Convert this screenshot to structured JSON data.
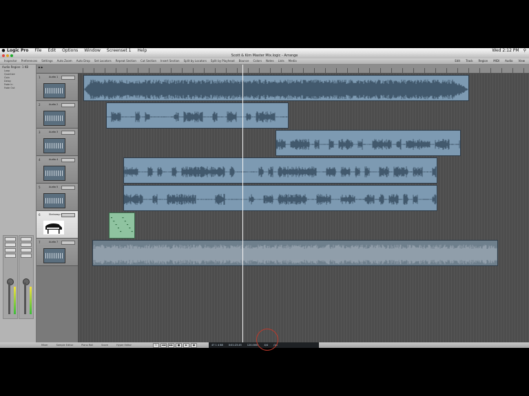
{
  "menubar": {
    "items": [
      "Logic Pro",
      "File",
      "Edit",
      "Options",
      "Window",
      "Screenset 1",
      "Help"
    ],
    "clock": "Wed 2:12 PM"
  },
  "window": {
    "title": "Scott & Kim Master Mix.logic - Arrange"
  },
  "toolbar": {
    "items": [
      "Inspector",
      "Preferences",
      "Settings",
      "Auto Zoom",
      "Auto Drop",
      "Set Locators",
      "Repeat Section",
      "Cut Section",
      "Insert Section",
      "Split by Locators",
      "Split by Playhead",
      "Bounce",
      "Colors",
      "Notes",
      "Lists",
      "Media"
    ],
    "right": [
      "Edit",
      "Track",
      "Region",
      "MIDI",
      "Audio",
      "View"
    ]
  },
  "inspector": {
    "header": "Audio Region: 1 KB",
    "params": [
      "Loop",
      "Quantize",
      "Gain",
      "Delay",
      "Fade In",
      "Fade Out"
    ]
  },
  "tracks": [
    {
      "num": "1",
      "name": "Audio 1"
    },
    {
      "num": "2",
      "name": "Audio 2"
    },
    {
      "num": "3",
      "name": "Audio 3"
    },
    {
      "num": "4",
      "name": "Audio 4"
    },
    {
      "num": "5",
      "name": "Audio 5"
    },
    {
      "num": "6",
      "name": "Steinway Grand"
    },
    {
      "num": "7",
      "name": "Audio 7"
    }
  ],
  "transport": {
    "tabs": [
      "Mixer",
      "Sample Editor",
      "Piano Roll",
      "Score",
      "Hyper Editor"
    ],
    "position": "47 1 4 88",
    "time": "0:01:23.45",
    "tempo": "120.0000",
    "signature": "4/4",
    "division": "/16",
    "buttons": [
      "loop-icon",
      "rewind-icon",
      "forward-icon",
      "stop-icon",
      "play-icon",
      "record-icon"
    ]
  },
  "colors": {
    "audio_region": "#7d9ab2",
    "midi_region": "#8fc3a0",
    "track_bg": "#4d4d4d"
  }
}
